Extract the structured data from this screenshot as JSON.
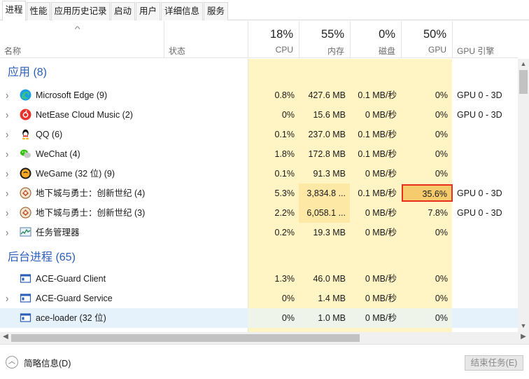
{
  "tabs": [
    "进程",
    "性能",
    "应用历史记录",
    "启动",
    "用户",
    "详细信息",
    "服务"
  ],
  "header": {
    "name": "名称",
    "status": "状态",
    "cpu": {
      "pct": "18%",
      "label": "CPU"
    },
    "mem": {
      "pct": "55%",
      "label": "内存"
    },
    "disk": {
      "pct": "0%",
      "label": "磁盘"
    },
    "gpu": {
      "pct": "50%",
      "label": "GPU"
    },
    "gpu_engine": "GPU 引擎"
  },
  "groups": {
    "apps": "应用 (8)",
    "background": "后台进程 (65)"
  },
  "apps": [
    {
      "name": "Microsoft Edge (9)",
      "cpu": "0.8%",
      "mem": "427.6 MB",
      "disk": "0.1 MB/秒",
      "gpu": "0%",
      "engine": "GPU 0 - 3D"
    },
    {
      "name": "NetEase Cloud Music (2)",
      "cpu": "0%",
      "mem": "15.6 MB",
      "disk": "0 MB/秒",
      "gpu": "0%",
      "engine": "GPU 0 - 3D"
    },
    {
      "name": "QQ (6)",
      "cpu": "0.1%",
      "mem": "237.0 MB",
      "disk": "0.1 MB/秒",
      "gpu": "0%",
      "engine": ""
    },
    {
      "name": "WeChat (4)",
      "cpu": "1.8%",
      "mem": "172.8 MB",
      "disk": "0.1 MB/秒",
      "gpu": "0%",
      "engine": ""
    },
    {
      "name": "WeGame (32 位) (9)",
      "cpu": "0.1%",
      "mem": "91.3 MB",
      "disk": "0 MB/秒",
      "gpu": "0%",
      "engine": ""
    },
    {
      "name": "地下城与勇士：创新世纪 (4)",
      "cpu": "5.3%",
      "mem": "3,834.8 ...",
      "disk": "0.1 MB/秒",
      "gpu": "35.6%",
      "engine": "GPU 0 - 3D"
    },
    {
      "name": "地下城与勇士：创新世纪 (3)",
      "cpu": "2.2%",
      "mem": "6,058.1 ...",
      "disk": "0 MB/秒",
      "gpu": "7.8%",
      "engine": "GPU 0 - 3D"
    },
    {
      "name": "任务管理器",
      "cpu": "0.2%",
      "mem": "19.3 MB",
      "disk": "0 MB/秒",
      "gpu": "0%",
      "engine": ""
    }
  ],
  "background": [
    {
      "name": "ACE-Guard Client",
      "cpu": "1.3%",
      "mem": "46.0 MB",
      "disk": "0 MB/秒",
      "gpu": "0%",
      "engine": ""
    },
    {
      "name": "ACE-Guard Service",
      "cpu": "0%",
      "mem": "1.4 MB",
      "disk": "0 MB/秒",
      "gpu": "0%",
      "engine": ""
    },
    {
      "name": "ace-loader (32 位)",
      "cpu": "0%",
      "mem": "1.0 MB",
      "disk": "0 MB/秒",
      "gpu": "0%",
      "engine": ""
    }
  ],
  "footer": {
    "fewer_details": "简略信息(D)",
    "end_task": "结束任务(E)"
  },
  "colors": {
    "group_title": "#2b5eb8",
    "heat_light": "#fff4c4",
    "heat_medium": "#fde8a6",
    "heat_high": "#f6cb6e",
    "highlight_border": "#e8301c",
    "selected_row": "#e5f1fb"
  },
  "icons": [
    "edge-icon",
    "netease-cloud-music-icon",
    "qq-icon",
    "wechat-icon",
    "wegame-icon",
    "dnf-icon",
    "dnf-icon",
    "task-manager-icon",
    "app-window-icon",
    "app-window-icon",
    "app-window-icon"
  ]
}
